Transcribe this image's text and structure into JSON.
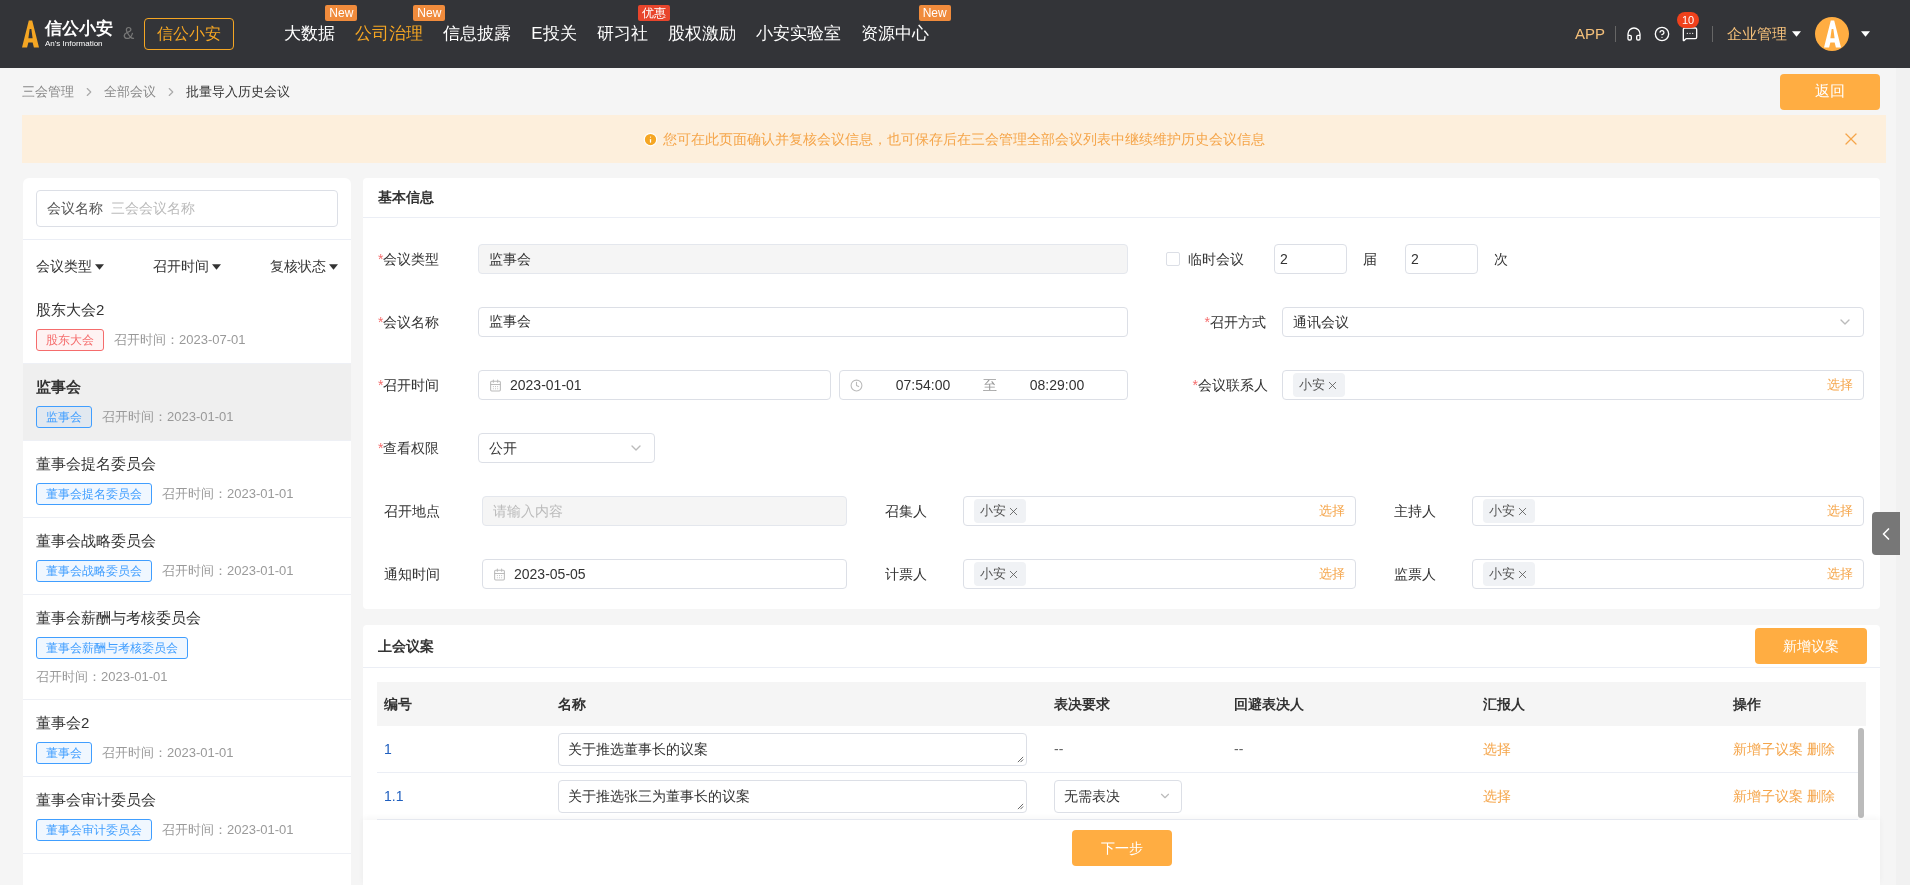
{
  "header": {
    "logo_text": "信公小安",
    "logo_sub": "An's Information",
    "amp": "&",
    "brand_button": "信公小安",
    "nav": [
      {
        "label": "大数据",
        "selected": false,
        "badge": {
          "text": "New",
          "color": "#f08b3c"
        }
      },
      {
        "label": "公司治理",
        "selected": true,
        "badge": {
          "text": "New",
          "color": "#f08b3c"
        }
      },
      {
        "label": "信息披露",
        "selected": false
      },
      {
        "label": "E投关",
        "selected": false
      },
      {
        "label": "研习社",
        "selected": false,
        "badge": {
          "text": "优惠",
          "color": "#e8452c"
        }
      },
      {
        "label": "股权激励",
        "selected": false
      },
      {
        "label": "小安实验室",
        "selected": false
      },
      {
        "label": "资源中心",
        "selected": false,
        "badge": {
          "text": "New",
          "color": "#f08b3c"
        }
      }
    ],
    "app_link": "APP",
    "notification_count": "10",
    "enterprise_menu": "企业管理"
  },
  "breadcrumb": [
    {
      "label": "三会管理",
      "current": false
    },
    {
      "label": "全部会议",
      "current": false
    },
    {
      "label": "批量导入历史会议",
      "current": true
    }
  ],
  "back_button": "返回",
  "notice": {
    "text": "您可在此页面确认并复核会议信息，也可保存后在三会管理全部会议列表中继续维护历史会议信息"
  },
  "sidebar": {
    "search": {
      "label": "会议名称",
      "placeholder": "三会会议名称"
    },
    "filters": [
      "会议类型",
      "召开时间",
      "复核状态"
    ],
    "meetings": [
      {
        "title": "股东大会2",
        "tag": "股东大会",
        "color": "#f56c6c",
        "time": "召开时间：2023-07-01",
        "selected": false
      },
      {
        "title": "监事会",
        "tag": "监事会",
        "color": "#409eff",
        "time": "召开时间：2023-01-01",
        "selected": true
      },
      {
        "title": "董事会提名委员会",
        "tag": "董事会提名委员会",
        "color": "#409eff",
        "time": "召开时间：2023-01-01",
        "selected": false
      },
      {
        "title": "董事会战略委员会",
        "tag": "董事会战略委员会",
        "color": "#409eff",
        "time": "召开时间：2023-01-01",
        "selected": false
      },
      {
        "title": "董事会薪酬与考核委员会",
        "tag": "董事会薪酬与考核委员会",
        "color": "#409eff",
        "time": "召开时间：2023-01-01",
        "selected": false
      },
      {
        "title": "董事会2",
        "tag": "董事会",
        "color": "#409eff",
        "time": "召开时间：2023-01-01",
        "selected": false
      },
      {
        "title": "董事会审计委员会",
        "tag": "董事会审计委员会",
        "color": "#409eff",
        "time": "召开时间：2023-01-01",
        "selected": false
      }
    ]
  },
  "basic_info": {
    "title": "基本信息",
    "meeting_type": {
      "label": "会议类型",
      "required_mark": "*",
      "value": "监事会"
    },
    "temporary": {
      "label": "临时会议",
      "checked": false
    },
    "session": {
      "value": "2",
      "unit": "届"
    },
    "sequence": {
      "value": "2",
      "unit": "次"
    },
    "meeting_name": {
      "label": "会议名称",
      "required_mark": "*",
      "value": "监事会"
    },
    "method": {
      "label": "召开方式",
      "required_mark": "*",
      "value": "通讯会议"
    },
    "time": {
      "label": "召开时间",
      "required_mark": "*",
      "date": "2023-01-01",
      "start": "07:54:00",
      "separator": "至",
      "end": "08:29:00"
    },
    "contact": {
      "label": "会议联系人",
      "required_mark": "*",
      "tags": [
        "小安"
      ],
      "action": "选择"
    },
    "permission": {
      "label": "查看权限",
      "required_mark": "*",
      "value": "公开"
    },
    "location": {
      "label": "召开地点",
      "placeholder": "请输入内容"
    },
    "notice_date": {
      "label": "通知时间",
      "value": "2023-05-05"
    },
    "people": [
      {
        "label": "召集人",
        "tags": [
          "小安"
        ],
        "action": "选择"
      },
      {
        "label": "主持人",
        "tags": [
          "小安"
        ],
        "action": "选择"
      },
      {
        "label": "计票人",
        "tags": [
          "小安"
        ],
        "action": "选择"
      },
      {
        "label": "监票人",
        "tags": [
          "小安"
        ],
        "action": "选择"
      }
    ]
  },
  "proposals": {
    "title": "上会议案",
    "add_button": "新增议案",
    "columns": [
      "编号",
      "名称",
      "表决要求",
      "回避表决人",
      "汇报人",
      "操作"
    ],
    "rows": [
      {
        "number": "1",
        "name": "关于推选董事长的议案",
        "requirement": {
          "kind": "text",
          "value": "--"
        },
        "recusal": "--",
        "reporter": "选择",
        "actions": [
          "新增子议案",
          "删除"
        ]
      },
      {
        "number": "1.1",
        "name": "关于推选张三为董事长的议案",
        "requirement": {
          "kind": "select",
          "value": "无需表决"
        },
        "reporter": "选择",
        "actions": [
          "新增子议案",
          "删除"
        ]
      }
    ]
  },
  "next_button": "下一步"
}
